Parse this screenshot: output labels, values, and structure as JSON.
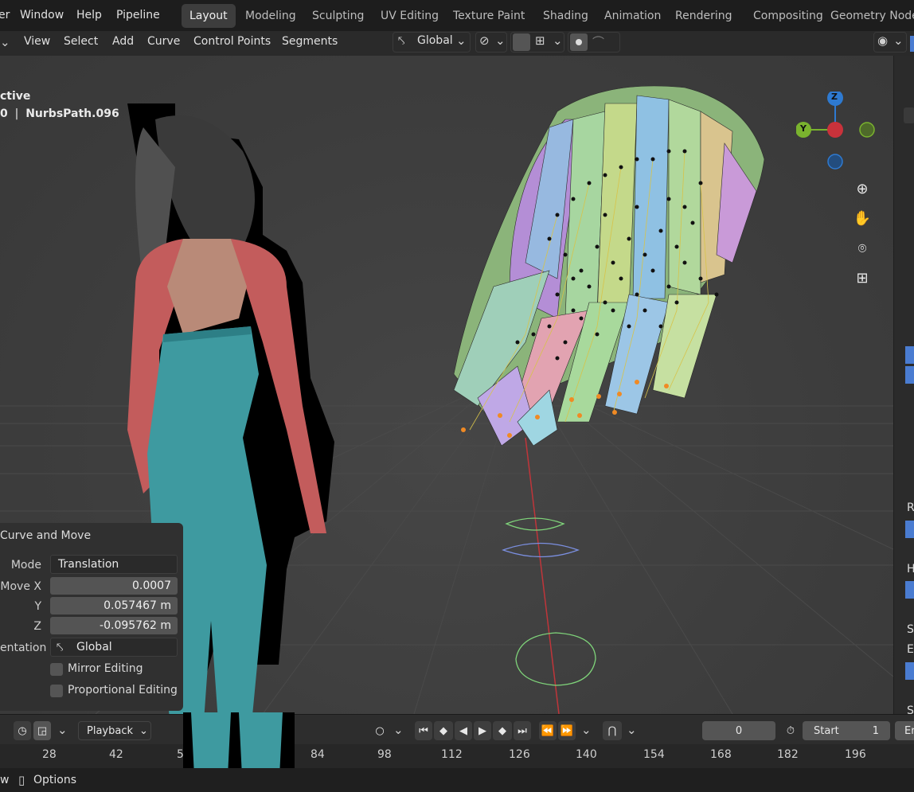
{
  "menu": [
    "er",
    "Window",
    "Help",
    "Pipeline"
  ],
  "workspace_tabs": [
    "Layout",
    "Modeling",
    "Sculpting",
    "UV Editing",
    "Texture Paint",
    "Shading",
    "Animation",
    "Rendering",
    "Compositing",
    "Geometry Node"
  ],
  "active_tab": "Layout",
  "header_menu": [
    "View",
    "Select",
    "Add",
    "Curve",
    "Control Points",
    "Segments"
  ],
  "transform_orientation": "Global",
  "object_info": {
    "mode": "ctive",
    "frame_prefix": "0",
    "object_name": "NurbsPath.096"
  },
  "gizmo": {
    "z": "Z",
    "y": "Y",
    "colors": {
      "x": "#c9323b",
      "y": "#7ab32e",
      "z": "#2e7ad1"
    }
  },
  "operator_panel": {
    "title": "Curve and Move",
    "mode_label": "Mode",
    "mode_value": "Translation",
    "move_x_label": "Move X",
    "move_x_value": "0.0007",
    "y_label": "Y",
    "y_value": "0.057467 m",
    "z_label": "Z",
    "z_value": "-0.095762 m",
    "orientation_label": "entation",
    "orientation_value": "Global",
    "mirror_label": "Mirror Editing",
    "proportional_label": "Proportional Editing"
  },
  "timeline": {
    "playback_label": "Playback",
    "current_frame": "0",
    "start_label": "Start",
    "start_value": "1",
    "end_label": "Er"
  },
  "ruler_ticks": [
    "28",
    "42",
    "5",
    "84",
    "98",
    "112",
    "126",
    "140",
    "154",
    "168",
    "182",
    "196"
  ],
  "status": {
    "left": "w",
    "options_label": "Options"
  },
  "right_panel": [
    "R",
    "H",
    "S",
    "El",
    "S"
  ]
}
